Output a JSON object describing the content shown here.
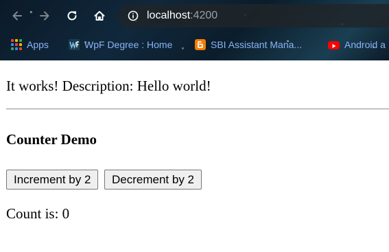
{
  "browser": {
    "address_host": "localhost",
    "address_port": ":4200",
    "bookmarks": [
      {
        "label": "Apps",
        "icon": "apps-grid-icon"
      },
      {
        "label": "WpF Degree : Home",
        "icon": "wpf-favicon"
      },
      {
        "label": "SBI Assistant Mana...",
        "icon": "blogger-icon"
      },
      {
        "label": "Android a",
        "icon": "youtube-icon"
      }
    ],
    "colors": {
      "bookmark_text": "#8ab4f8",
      "omnibox_host": "#ffffff",
      "omnibox_port": "#9aa0a6"
    }
  },
  "page": {
    "description": "It works! Description: Hello world!",
    "counter_title": "Counter Demo",
    "increment_label": "Increment by 2",
    "decrement_label": "Decrement by 2",
    "count_text": "Count is: 0"
  }
}
